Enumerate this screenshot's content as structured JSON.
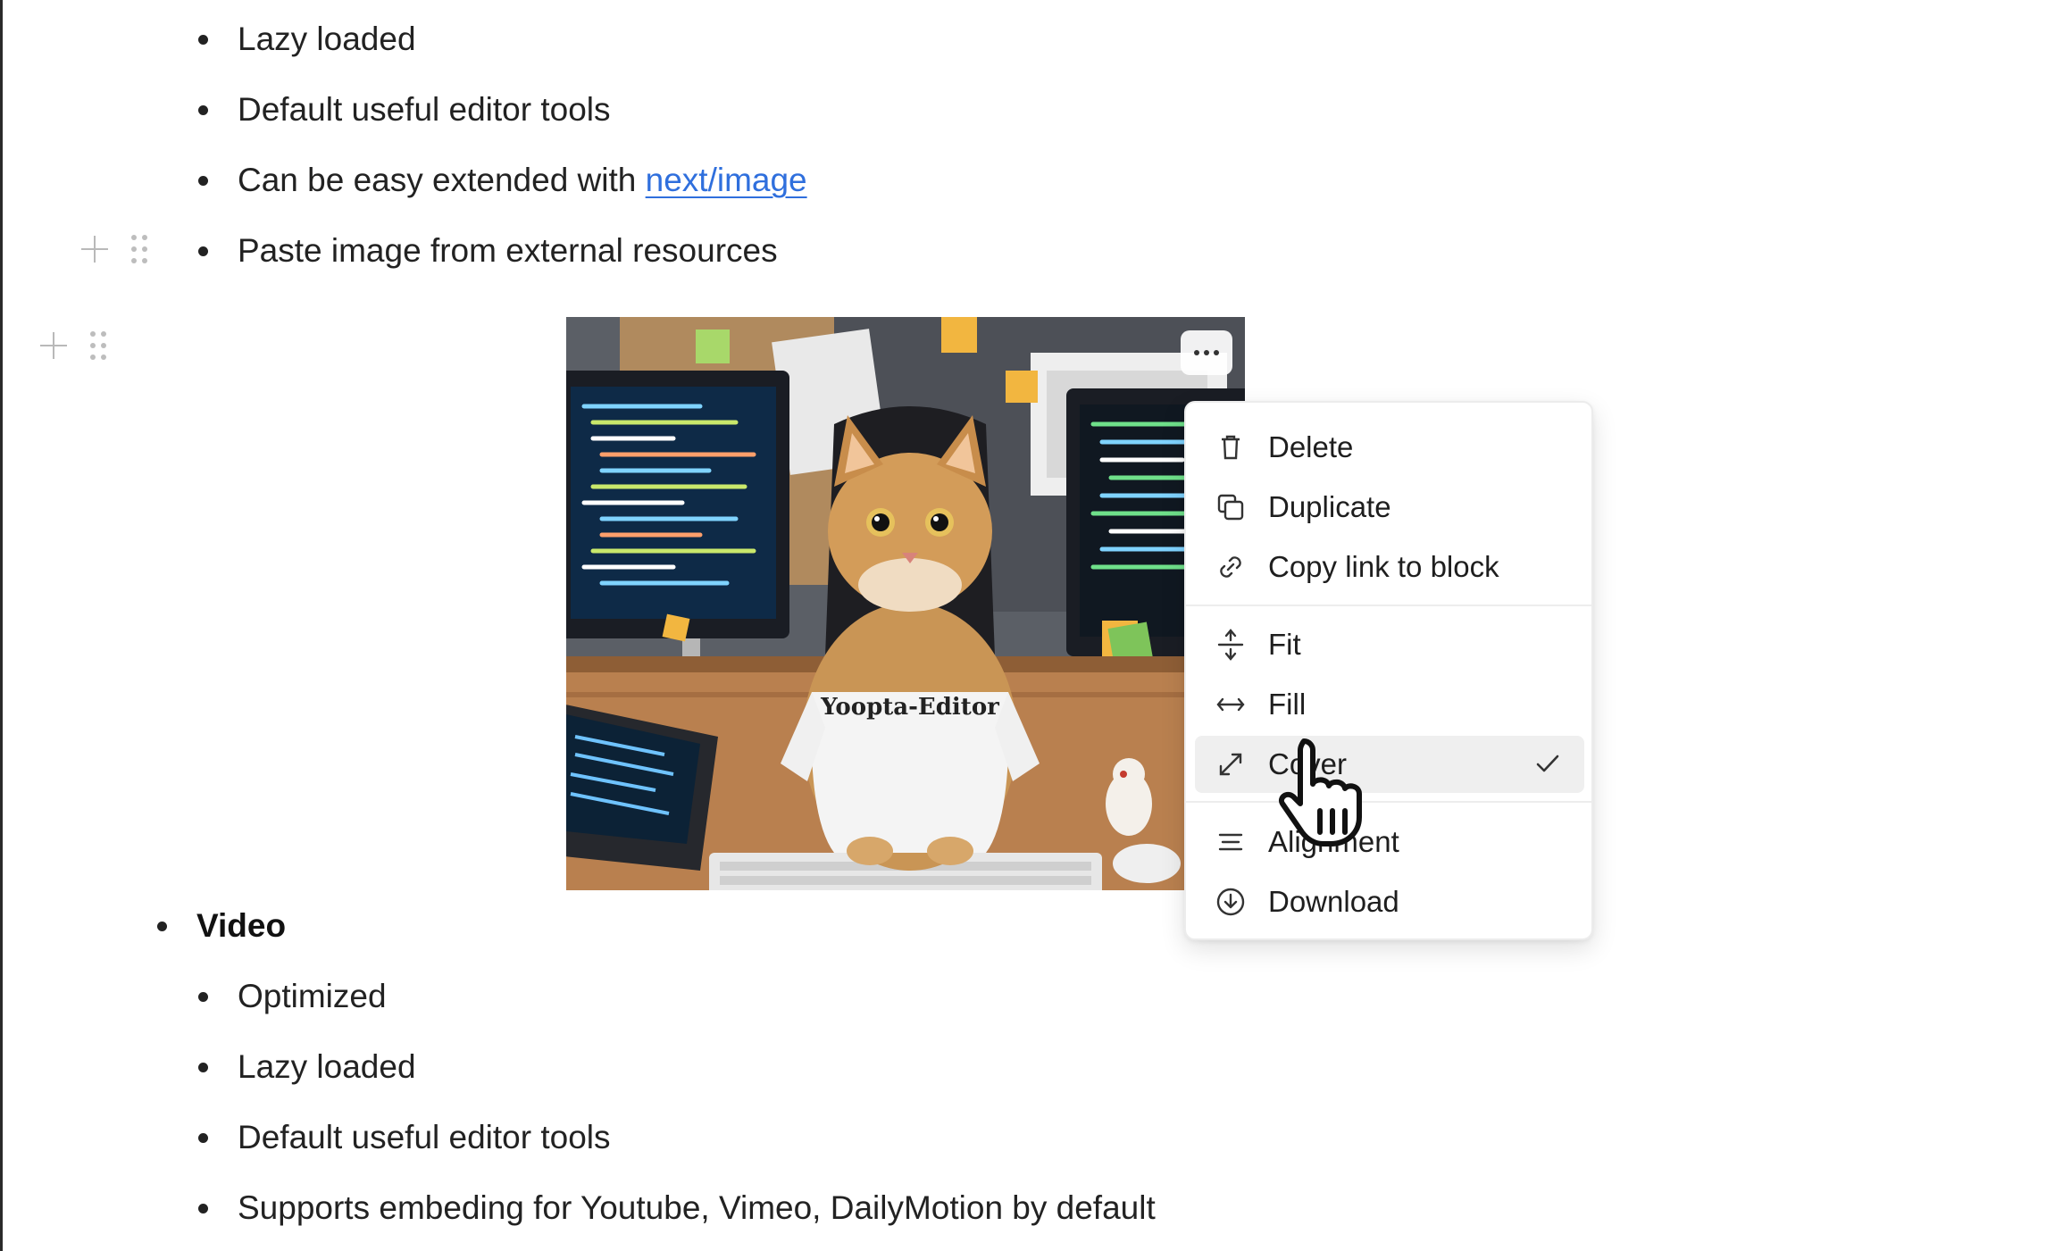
{
  "top_list": [
    {
      "text": "Lazy loaded"
    },
    {
      "text": "Default useful editor tools"
    },
    {
      "text_before": "Can be easy extended with ",
      "link": "next/image"
    },
    {
      "text": "Paste image from external resources"
    }
  ],
  "image": {
    "alt": "Cat wearing Yoopta-Editor t-shirt at a desk with monitors",
    "shirt_text": "Yoopta-Editor"
  },
  "image_menu": {
    "more_label": "...",
    "items": [
      {
        "label": "Delete",
        "icon": "trash-icon"
      },
      {
        "label": "Duplicate",
        "icon": "duplicate-icon"
      },
      {
        "label": "Copy link to block",
        "icon": "link-icon"
      },
      {
        "label": "Fit",
        "icon": "fit-icon"
      },
      {
        "label": "Fill",
        "icon": "fill-icon"
      },
      {
        "label": "Cover",
        "icon": "cover-icon",
        "selected": true
      },
      {
        "label": "Alignment",
        "icon": "align-icon"
      },
      {
        "label": "Download",
        "icon": "download-icon"
      }
    ]
  },
  "video_section": {
    "heading": "Video",
    "items": [
      "Optimized",
      "Lazy loaded",
      "Default useful editor tools",
      "Supports embeding for Youtube, Vimeo, DailyMotion by default"
    ]
  }
}
